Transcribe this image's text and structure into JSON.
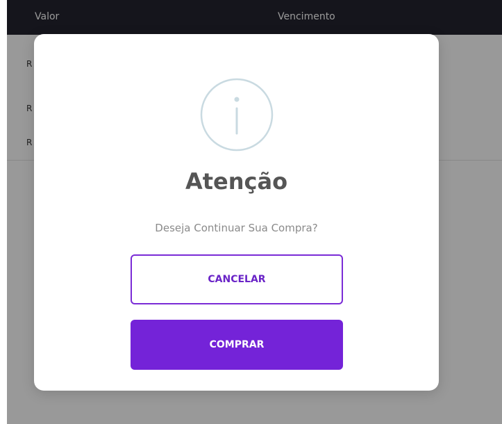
{
  "table": {
    "headers": [
      "Valor",
      "Vencimento"
    ],
    "rows": [
      {
        "valor": "R"
      },
      {
        "valor": "R"
      },
      {
        "valor": "R"
      }
    ]
  },
  "modal": {
    "icon": "info-icon",
    "title": "Atenção",
    "message": "Deseja Continuar Sua Compra?",
    "cancel_label": "CANCELAR",
    "confirm_label": "COMPRAR"
  },
  "colors": {
    "header_bg": "#232330",
    "accent": "#7423d8",
    "icon_stroke": "#c9dae1"
  }
}
